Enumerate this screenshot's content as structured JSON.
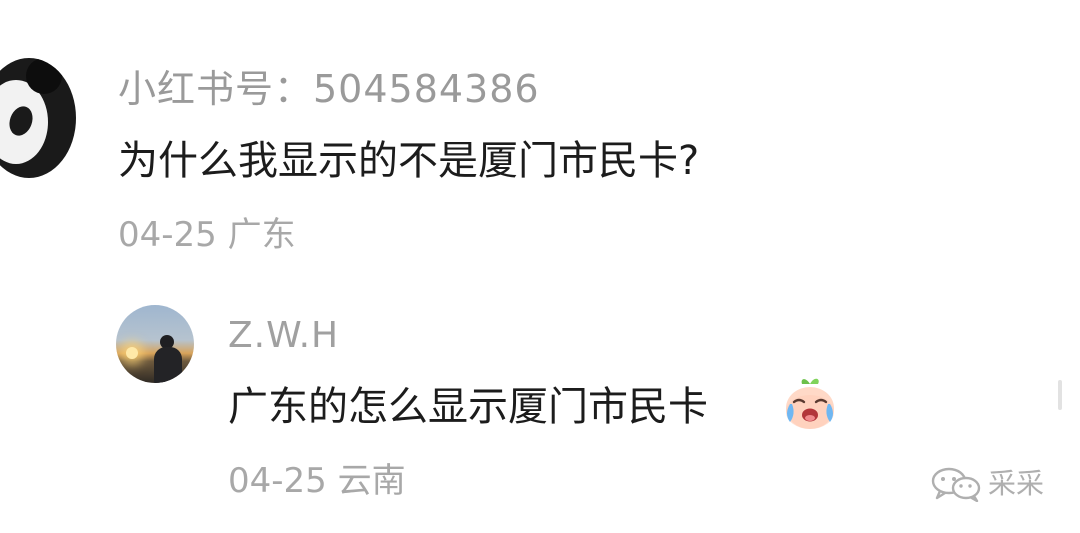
{
  "comment": {
    "username": "小红书号：504584386",
    "content": "为什么我显示的不是厦门市民卡?",
    "meta": "04-25 广东",
    "avatar": "panda-avatar"
  },
  "reply": {
    "username": "Z.W.H",
    "content": "广东的怎么显示厦门市民卡",
    "emoji": "crying-face-emoji",
    "meta": "04-25 云南",
    "avatar": "sunset-silhouette-avatar"
  },
  "watermark": {
    "text": "采采",
    "icon": "wechat-icon"
  },
  "colors": {
    "username": "#9a9a9a",
    "content": "#1c1c1c",
    "meta": "#a8a8a8",
    "background": "#ffffff"
  }
}
